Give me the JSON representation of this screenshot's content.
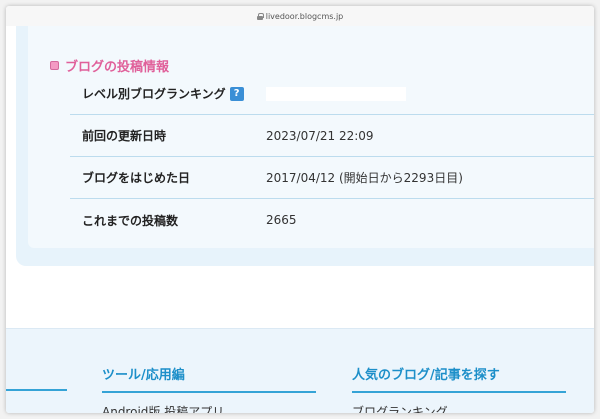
{
  "browser": {
    "url": "livedoor.blogcms.jp"
  },
  "section": {
    "title": "ブログの投稿情報"
  },
  "rows": [
    {
      "label": "レベル別ブログランキング",
      "value": ""
    },
    {
      "label": "前回の更新日時",
      "value": "2023/07/21 22:09"
    },
    {
      "label": "ブログをはじめた日",
      "value": "2017/04/12 (開始日から2293日目)"
    },
    {
      "label": "これまでの投稿数",
      "value": "2665"
    }
  ],
  "help_icon": "?",
  "footer": {
    "col1": {
      "heading": "ツール/応用編",
      "link": "Android版 投稿アプリ"
    },
    "col2": {
      "heading": "人気のブログ/記事を探す",
      "link": "ブログランキング"
    }
  }
}
